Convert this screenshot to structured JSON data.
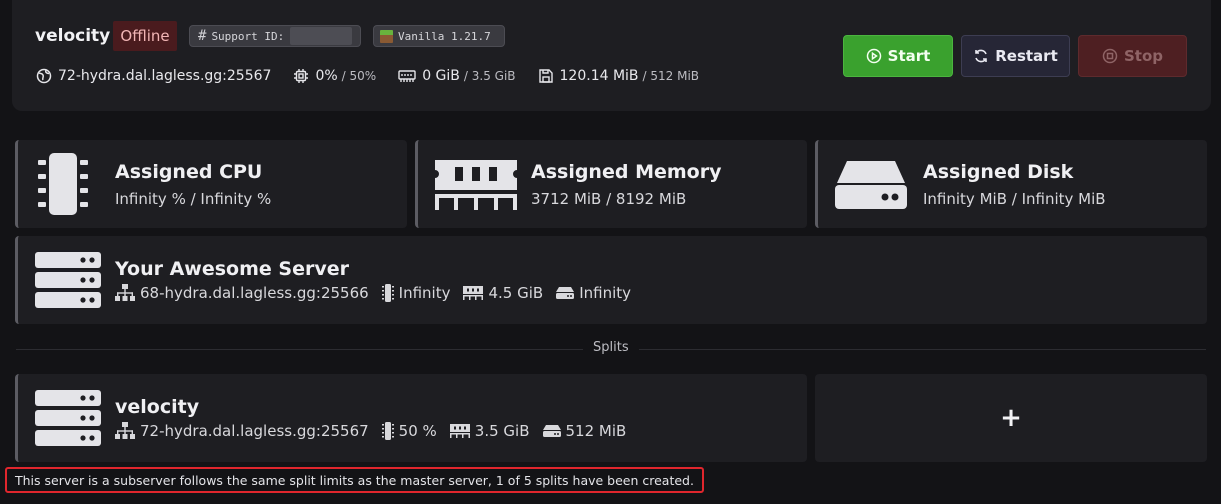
{
  "header": {
    "server_name": "velocity",
    "status": "Offline",
    "support_id_label": "Support ID:",
    "version": "Vanilla 1.21.7",
    "address": "72-hydra.dal.lagless.gg:25567",
    "cpu_value": "0%",
    "cpu_limit": "/ 50%",
    "memory_value": "0 GiB",
    "memory_limit": "/ 3.5 GiB",
    "disk_value": "120.14 MiB",
    "disk_limit": "/ 512 MiB",
    "start_label": "Start",
    "restart_label": "Restart",
    "stop_label": "Stop"
  },
  "assigned": {
    "cpu": {
      "title": "Assigned CPU",
      "value": "Infinity % / Infinity %"
    },
    "memory": {
      "title": "Assigned Memory",
      "value": "3712 MiB / 8192 MiB"
    },
    "disk": {
      "title": "Assigned Disk",
      "value": "Infinity MiB / Infinity MiB"
    }
  },
  "master_server": {
    "name": "Your Awesome Server",
    "address": "68-hydra.dal.lagless.gg:25566",
    "cpu": "Infinity",
    "memory": "4.5 GiB",
    "disk": "Infinity"
  },
  "splits": {
    "label": "Splits",
    "items": [
      {
        "name": "velocity",
        "address": "72-hydra.dal.lagless.gg:25567",
        "cpu": "50 %",
        "memory": "3.5 GiB",
        "disk": "512 MiB"
      }
    ],
    "add_label": "+"
  },
  "notice": "This server is a subserver follows the same split limits as the master server, 1 of 5 splits have been created.",
  "colors": {
    "accent_start": "#3aa12e",
    "status_offline": "#4a1b1e",
    "stop": "#4e1f22",
    "notice_border": "#e0262d"
  }
}
